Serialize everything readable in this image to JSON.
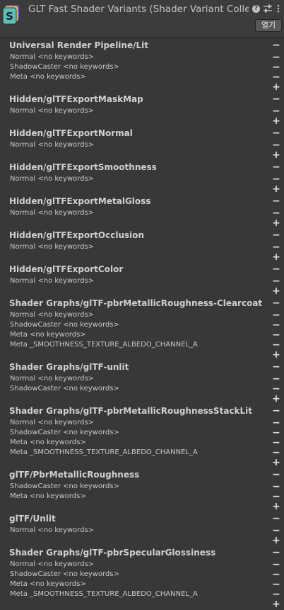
{
  "window": {
    "title": "GLT Fast Shader Variants (Shader Variant Collection)",
    "open_label": "열기",
    "help_glyph": "?",
    "icon_letter": "S"
  },
  "groups": [
    {
      "name": "Universal Render Pipeline/Lit",
      "variants": [
        "Normal <no keywords>",
        "ShadowCaster <no keywords>",
        "Meta <no keywords>"
      ]
    },
    {
      "name": "Hidden/glTFExportMaskMap",
      "variants": [
        "Normal <no keywords>"
      ]
    },
    {
      "name": "Hidden/glTFExportNormal",
      "variants": [
        "Normal <no keywords>"
      ]
    },
    {
      "name": "Hidden/glTFExportSmoothness",
      "variants": [
        "Normal <no keywords>"
      ]
    },
    {
      "name": "Hidden/glTFExportMetalGloss",
      "variants": [
        "Normal <no keywords>"
      ]
    },
    {
      "name": "Hidden/glTFExportOcclusion",
      "variants": [
        "Normal <no keywords>"
      ]
    },
    {
      "name": "Hidden/glTFExportColor",
      "variants": [
        "Normal <no keywords>"
      ]
    },
    {
      "name": "Shader Graphs/glTF-pbrMetallicRoughness-Clearcoat",
      "variants": [
        "Normal <no keywords>",
        "ShadowCaster <no keywords>",
        "Meta <no keywords>",
        "Meta _SMOOTHNESS_TEXTURE_ALBEDO_CHANNEL_A"
      ]
    },
    {
      "name": "Shader Graphs/glTF-unlit",
      "variants": [
        "Normal <no keywords>",
        "ShadowCaster <no keywords>"
      ]
    },
    {
      "name": "Shader Graphs/glTF-pbrMetallicRoughnessStackLit",
      "variants": [
        "Normal <no keywords>",
        "ShadowCaster <no keywords>",
        "Meta <no keywords>",
        "Meta _SMOOTHNESS_TEXTURE_ALBEDO_CHANNEL_A"
      ]
    },
    {
      "name": "glTF/PbrMetallicRoughness",
      "variants": [
        "ShadowCaster <no keywords>",
        "Meta <no keywords>"
      ]
    },
    {
      "name": "glTF/Unlit",
      "variants": [
        "Normal <no keywords>"
      ]
    },
    {
      "name": "Shader Graphs/glTF-pbrSpecularGlossiness",
      "variants": [
        "Normal <no keywords>",
        "ShadowCaster <no keywords>",
        "Meta <no keywords>",
        "Meta _SMOOTHNESS_TEXTURE_ALBEDO_CHANNEL_A"
      ]
    }
  ],
  "glyphs": {
    "remove": "−",
    "add": "+"
  },
  "icons": {
    "asset": "shader-variant-collection-icon",
    "help": "help-icon",
    "preset": "preset-sliders-icon",
    "menu": "kebab-menu-icon"
  },
  "colors": {
    "background": "#383838",
    "header": "#3c3c3c",
    "text": "#d2d2d2",
    "icon_teal": "#5bc0b8",
    "icon_purple": "#7b5aa6",
    "icon_yellow": "#e8d35a"
  }
}
